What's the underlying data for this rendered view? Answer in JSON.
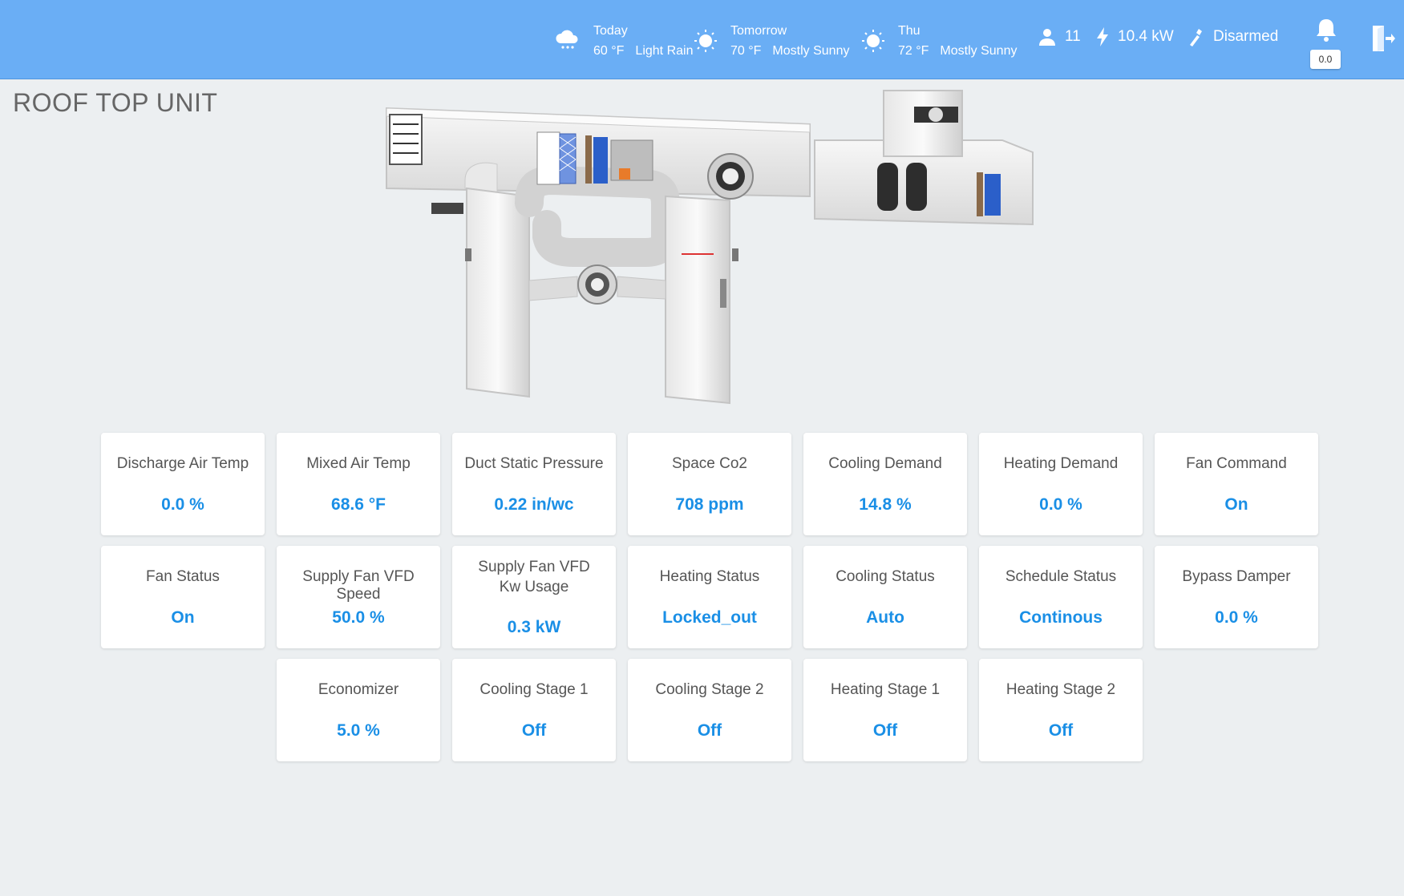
{
  "header": {
    "weather": [
      {
        "day": "Today",
        "temp": "60 °F",
        "condition": "Light Rain",
        "icon": "rain-cloud-icon"
      },
      {
        "day": "Tomorrow",
        "temp": "70 °F",
        "condition": "Mostly Sunny",
        "icon": "sun-icon"
      },
      {
        "day": "Thu",
        "temp": "72 °F",
        "condition": "Mostly Sunny",
        "icon": "sun-icon"
      }
    ],
    "occupants": "11",
    "power": "10.4 kW",
    "security": "Disarmed",
    "alerts_badge": "0.0"
  },
  "page": {
    "title": "ROOF TOP UNIT"
  },
  "cards": [
    {
      "title": "Discharge Air Temp",
      "value": "0.0 %"
    },
    {
      "title": "Mixed Air Temp",
      "value": "68.6 °F"
    },
    {
      "title": "Duct Static Pressure",
      "value": "0.22 in/wc"
    },
    {
      "title": "Space Co2",
      "value": "708 ppm"
    },
    {
      "title": "Cooling Demand",
      "value": "14.8 %"
    },
    {
      "title": "Heating Demand",
      "value": "0.0 %"
    },
    {
      "title": "Fan Command",
      "value": "On"
    },
    {
      "title": "Fan Status",
      "value": "On"
    },
    {
      "title": "Supply Fan VFD Speed",
      "value": "50.0 %"
    },
    {
      "title": "Supply Fan VFD Kw Usage",
      "value": "0.3 kW"
    },
    {
      "title": "Heating Status",
      "value": "Locked_out"
    },
    {
      "title": "Cooling Status",
      "value": "Auto"
    },
    {
      "title": "Schedule Status",
      "value": "Continous"
    },
    {
      "title": "Bypass Damper",
      "value": "0.0 %"
    },
    {
      "title": "Economizer",
      "value": "5.0 %"
    },
    {
      "title": "Cooling Stage 1",
      "value": "Off"
    },
    {
      "title": "Cooling Stage 2",
      "value": "Off"
    },
    {
      "title": "Heating Stage 1",
      "value": "Off"
    },
    {
      "title": "Heating Stage 2",
      "value": "Off"
    }
  ],
  "colors": {
    "header": "#6aaef5",
    "value": "#1a8fe6",
    "background": "#eceff1"
  }
}
